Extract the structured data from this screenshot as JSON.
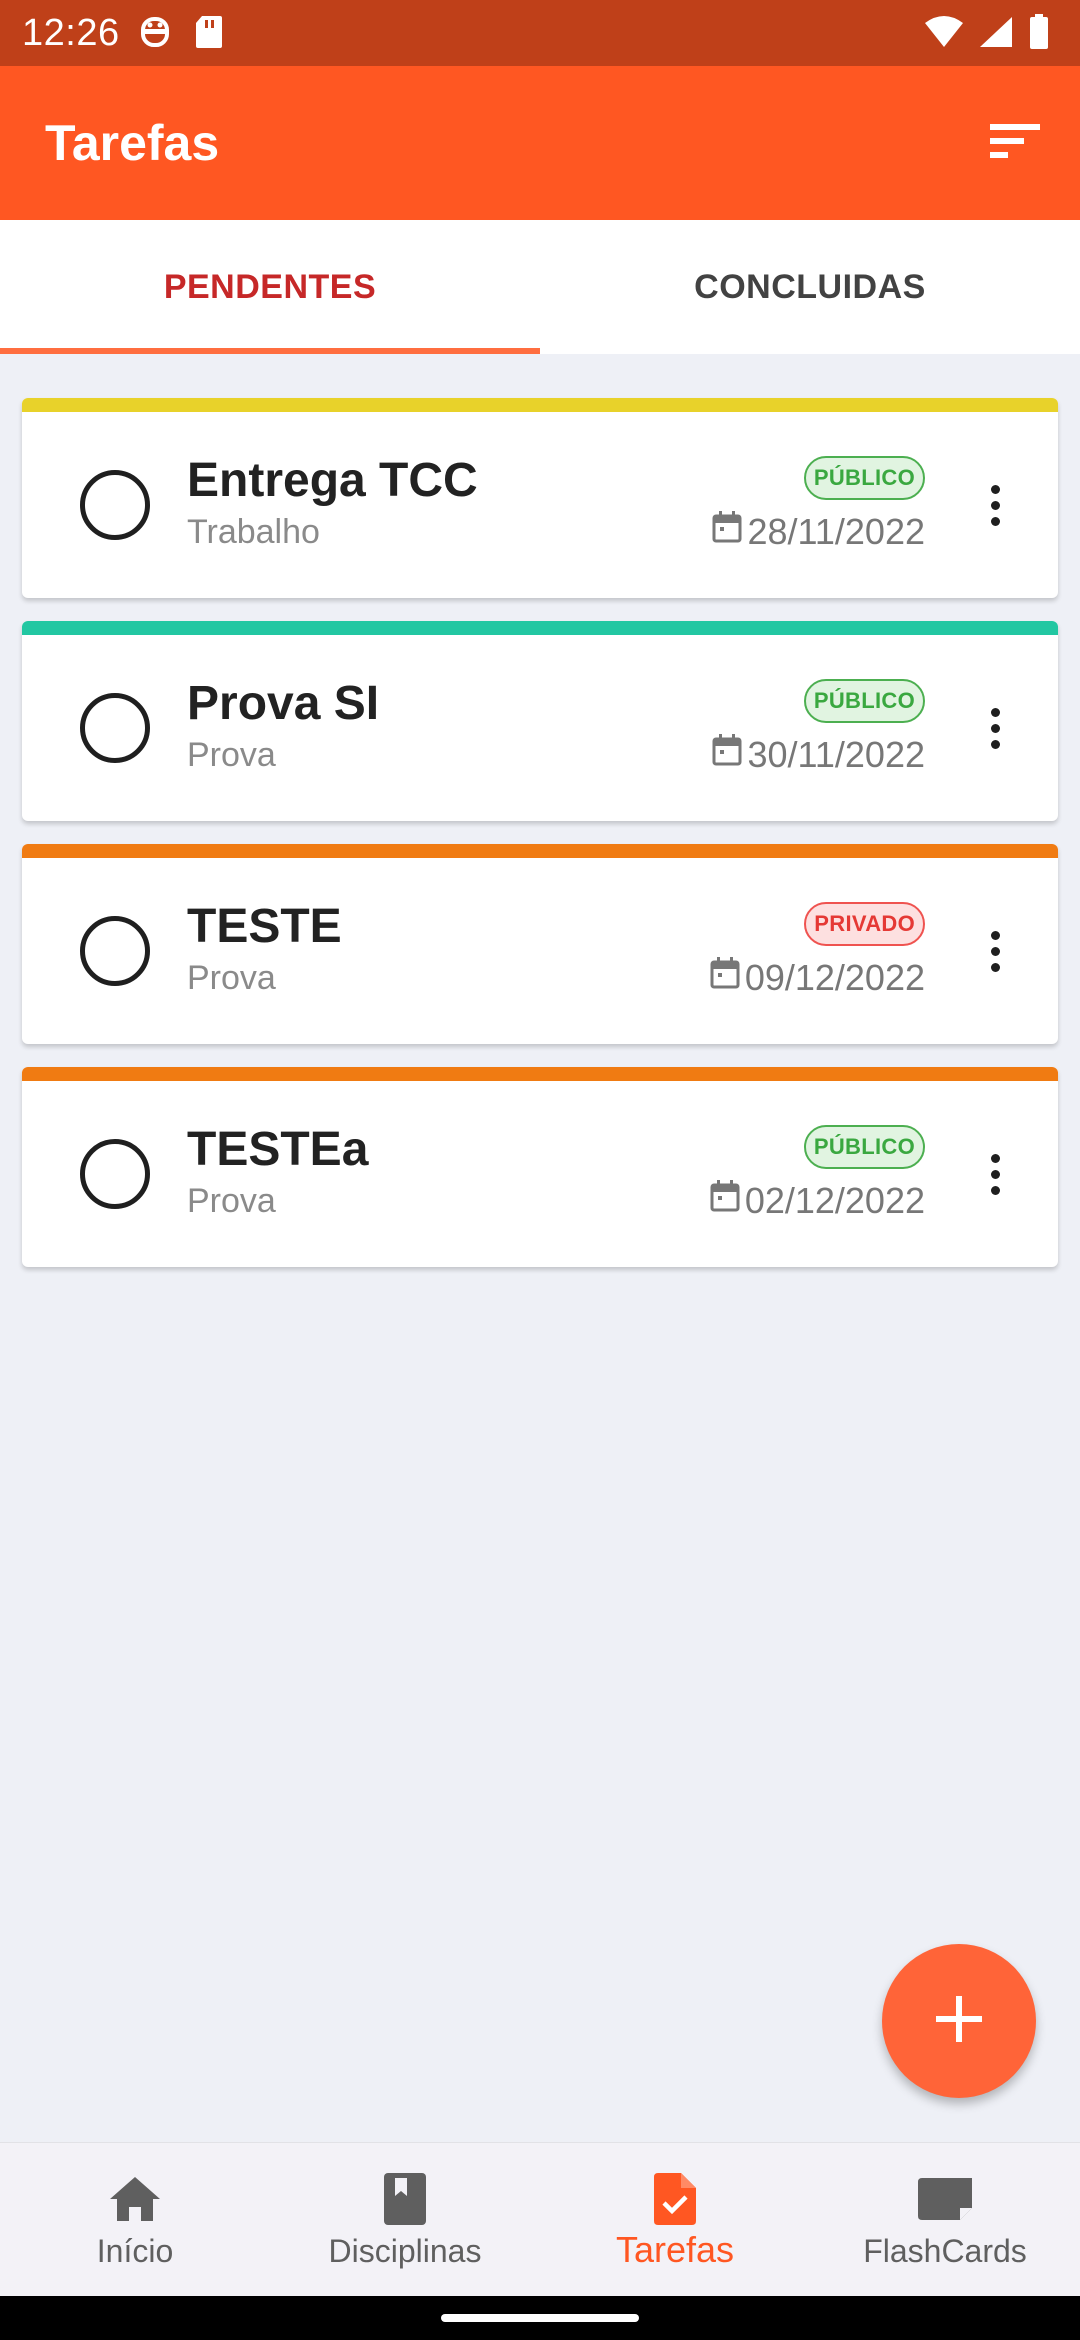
{
  "status_bar": {
    "time": "12:26"
  },
  "app_bar": {
    "title": "Tarefas"
  },
  "tabs": [
    {
      "label": "PENDENTES",
      "active": true
    },
    {
      "label": "CONCLUIDAS",
      "active": false
    }
  ],
  "tasks": [
    {
      "title": "Entrega TCC",
      "subtitle": "Trabalho",
      "visibility": "PÚBLICO",
      "date": "28/11/2022",
      "stripe_color": "#e8d22a"
    },
    {
      "title": "Prova SI",
      "subtitle": "Prova",
      "visibility": "PÚBLICO",
      "date": "30/11/2022",
      "stripe_color": "#22c7a2"
    },
    {
      "title": "TESTE",
      "subtitle": "Prova",
      "visibility": "PRIVADO",
      "date": "09/12/2022",
      "stripe_color": "#f07b12"
    },
    {
      "title": "TESTEa",
      "subtitle": "Prova",
      "visibility": "PÚBLICO",
      "date": "02/12/2022",
      "stripe_color": "#f07b12"
    }
  ],
  "bottom_nav": [
    {
      "label": "Início",
      "icon": "home-icon",
      "active": false
    },
    {
      "label": "Disciplinas",
      "icon": "book-icon",
      "active": false
    },
    {
      "label": "Tarefas",
      "icon": "task-file-icon",
      "active": true
    },
    {
      "label": "FlashCards",
      "icon": "flashcard-icon",
      "active": false
    }
  ],
  "colors": {
    "primary": "#ff5722",
    "status_bar": "#bf4019",
    "active_tab": "#c62828",
    "public_badge": "#4caf50",
    "private_badge": "#ef5350"
  }
}
